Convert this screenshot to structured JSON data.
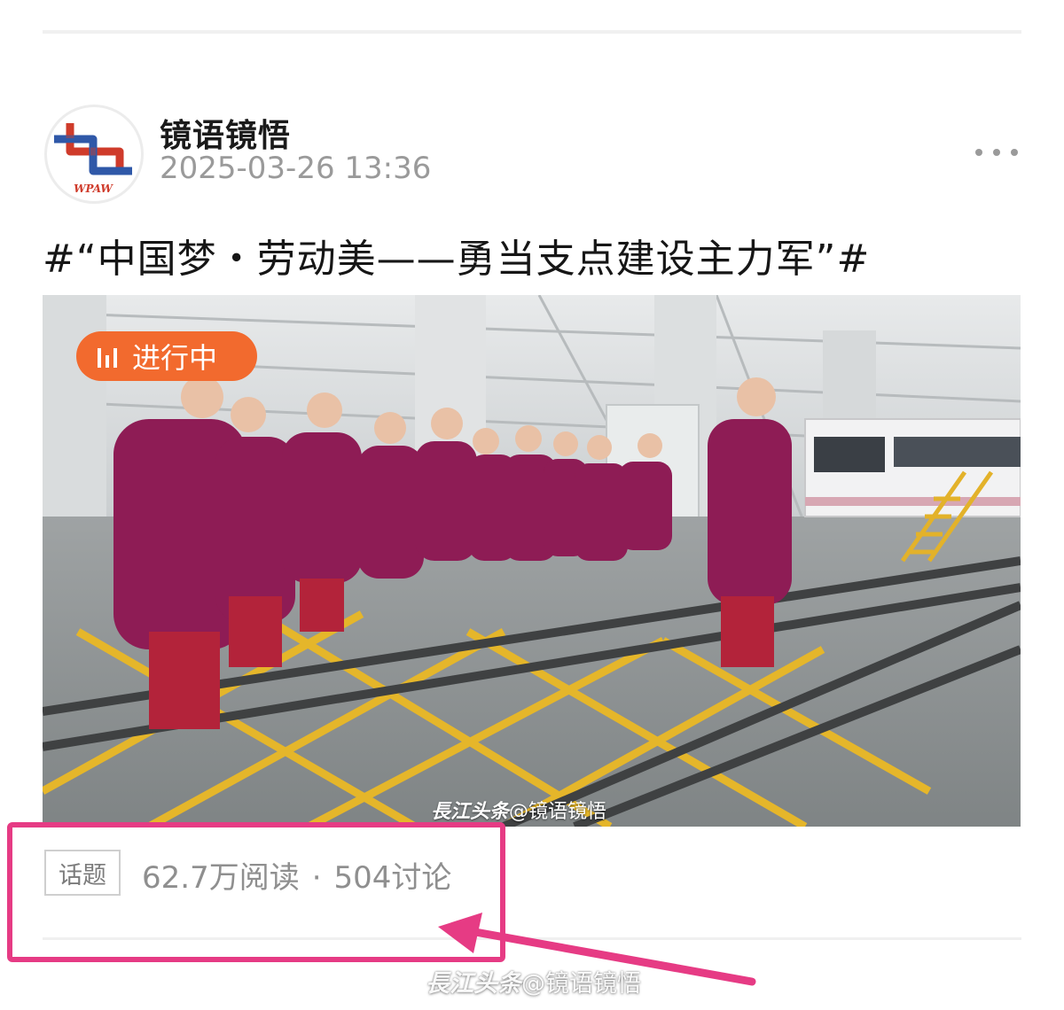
{
  "post": {
    "author_name": "镜语镜悟",
    "avatar_logo_text": "WPAW",
    "timestamp": "2025-03-26 13:36",
    "headline": "#“中国梦・劳动美——勇当支点建设主力军”#",
    "more_icon": "more-horizontal-icon"
  },
  "image": {
    "live_badge": "进行中",
    "live_badge_icon": "bar-chart-icon",
    "watermark_brand": "長江头条",
    "watermark_handle": "@镜语镜悟"
  },
  "topic": {
    "tag": "话题",
    "reads": "62.7万阅读",
    "separator": "·",
    "discussions": "504讨论"
  },
  "overlay": {
    "watermark_brand": "長江头条",
    "watermark_handle": "@镜语镜悟",
    "highlight_color": "#e63b84"
  },
  "colors": {
    "badge": "#f26a2e",
    "uniform": "#8e1c55",
    "text_primary": "#161616",
    "text_secondary": "#9a9a9a"
  }
}
